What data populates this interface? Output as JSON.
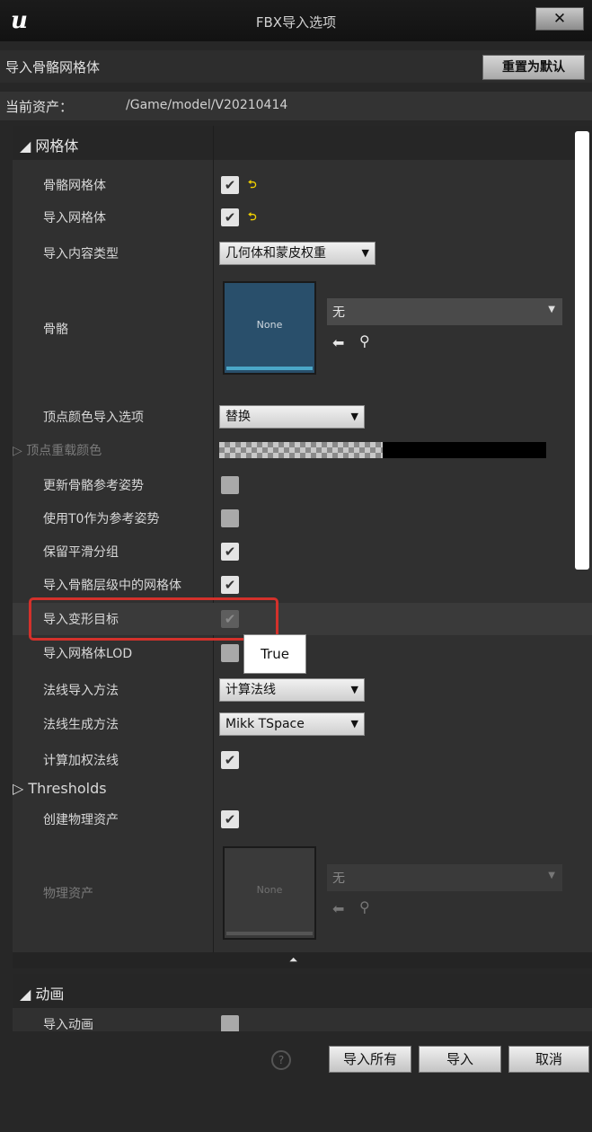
{
  "window": {
    "title": "FBX导入选项",
    "close_label": "✕"
  },
  "header": {
    "label": "导入骨骼网格体",
    "reset_label": "重置为默认"
  },
  "asset": {
    "label": "当前资产：",
    "path": "/Game/model/V20210414"
  },
  "mesh_section": {
    "title": "◢ 网格体",
    "skeletal_mesh": "骨骼网格体",
    "import_mesh": "导入网格体",
    "content_type_label": "导入内容类型",
    "content_type_value": "几何体和蒙皮权重",
    "skeleton_label": "骨骼",
    "skeleton_thumb": "None",
    "skeleton_value": "无",
    "vertex_color_label": "顶点颜色导入选项",
    "vertex_color_value": "替换",
    "vertex_override_color": "▷ 顶点重载颜色",
    "update_skeleton_ref_pose": "更新骨骼参考姿势",
    "use_t0_ref_pose": "使用T0作为参考姿势",
    "preserve_smoothing_groups": "保留平滑分组",
    "import_meshes_in_bone_hierarchy": "导入骨骼层级中的网格体",
    "import_morph_targets": "导入变形目标",
    "tooltip": "True",
    "import_mesh_lods": "导入网格体LOD",
    "normal_import_method_label": "法线导入方法",
    "normal_import_method_value": "计算法线",
    "normal_generation_method_label": "法线生成方法",
    "normal_generation_method_value": "Mikk TSpace",
    "compute_weighted_normals": "计算加权法线",
    "thresholds": "▷ Thresholds",
    "create_physics_asset": "创建物理资产",
    "physics_asset_label": "物理资产",
    "physics_thumb": "None",
    "physics_value": "无"
  },
  "animation_section": {
    "title": "◢ 动画",
    "import_animations": "导入动画"
  },
  "footer": {
    "help": "?",
    "import_all": "导入所有",
    "import": "导入",
    "cancel": "取消"
  },
  "glyphs": {
    "check": "✔",
    "reset_arrow": "⮌",
    "dropdown": "▼",
    "back": "⬅",
    "search": "⚲",
    "collapse": "⏶"
  }
}
